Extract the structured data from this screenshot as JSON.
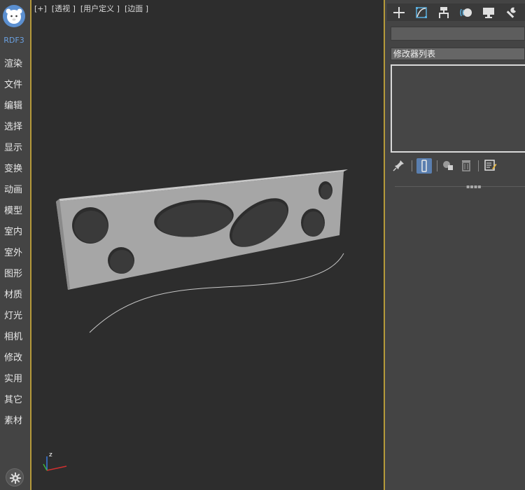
{
  "left_menu": {
    "brand": "RDF3",
    "items": [
      {
        "label": "渲染"
      },
      {
        "label": "文件"
      },
      {
        "label": "编辑"
      },
      {
        "label": "选择"
      },
      {
        "label": "显示"
      },
      {
        "label": "变换"
      },
      {
        "label": "动画"
      },
      {
        "label": "模型"
      },
      {
        "label": "室内"
      },
      {
        "label": "室外"
      },
      {
        "label": "图形"
      },
      {
        "label": "材质"
      },
      {
        "label": "灯光"
      },
      {
        "label": "相机"
      },
      {
        "label": "修改"
      },
      {
        "label": "实用"
      },
      {
        "label": "其它"
      },
      {
        "label": "素材"
      }
    ],
    "bottom_icon": "settings-icon"
  },
  "viewport": {
    "label": "[+]  [透视 ]  [用户定义 ]  [边面 ]",
    "axis_label": "z"
  },
  "command_panel": {
    "tabs": [
      {
        "icon": "create-plus-icon"
      },
      {
        "icon": "modify-curve-icon"
      },
      {
        "icon": "hierarchy-icon"
      },
      {
        "icon": "motion-icon"
      },
      {
        "icon": "display-monitor-icon"
      },
      {
        "icon": "utilities-wrench-icon"
      }
    ],
    "object_name": "",
    "modifier_list": "修改器列表",
    "stack_tools": [
      {
        "icon": "pin-icon"
      },
      {
        "icon": "show-end-result-icon"
      },
      {
        "icon": "make-unique-icon"
      },
      {
        "icon": "remove-modifier-icon"
      },
      {
        "icon": "configure-modifier-sets-icon"
      }
    ]
  },
  "colors": {
    "accent_border": "#b59a3a",
    "panel_bg": "#444444",
    "viewport_bg": "#2d2d2d",
    "brand_blue": "#5b8fd0"
  }
}
